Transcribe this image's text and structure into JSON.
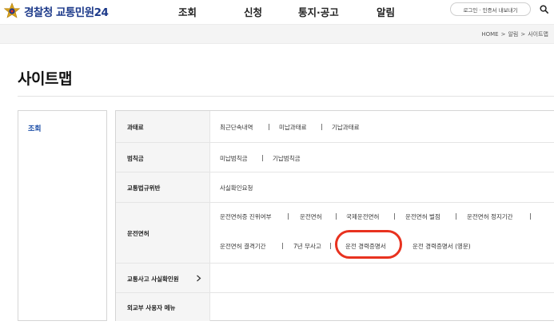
{
  "header": {
    "logo_text": "경찰청 교통민원24",
    "nav": [
      "조회",
      "신청",
      "통지·공고",
      "알림"
    ],
    "login_label": "로그인 · 인증서 내보내기"
  },
  "breadcrumb": [
    "HOME",
    "알림",
    "사이트맵"
  ],
  "page_title": "사이트맵",
  "sidebar": {
    "active_label": "조회"
  },
  "sitemap": {
    "rows": [
      {
        "label": "과태료",
        "links": [
          "최근단속내역",
          "미납과태료",
          "기납과태료"
        ]
      },
      {
        "label": "범칙금",
        "links": [
          "미납범칙금",
          "기납범칙금"
        ]
      },
      {
        "label": "교통법규위반",
        "links": [
          "사실확인요청"
        ]
      },
      {
        "label": "운전면허",
        "links": [
          "운전면허증 진위여부",
          "운전면허",
          "국제운전면허",
          "운전면허 벌점",
          "운전면허 정지기간",
          "운전면허 결격기간",
          "7년 무사고",
          "운전 경력증명서",
          "운전 경력증명서 (영문)"
        ]
      },
      {
        "label": "교통사고 사실확인원",
        "links": []
      },
      {
        "label": "외교부 사용자 메뉴",
        "links": []
      }
    ]
  },
  "colors": {
    "brand": "#1d3a8a",
    "side_active": "#1d4fa8",
    "highlight": "#e8321f"
  }
}
